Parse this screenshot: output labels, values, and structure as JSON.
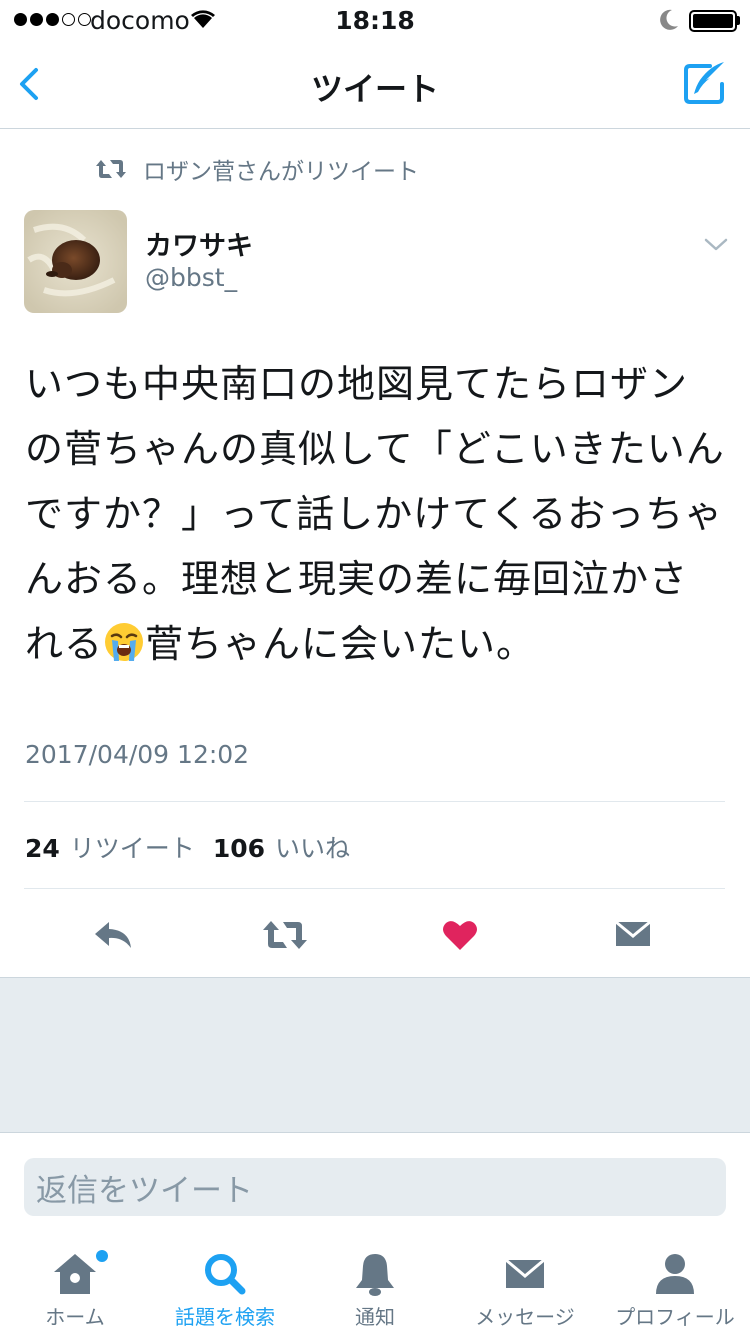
{
  "status_bar": {
    "carrier": "docomo",
    "time": "18:18",
    "signal_bars_filled": 3,
    "signal_bars_total": 5,
    "battery_level": 1.0
  },
  "nav": {
    "title": "ツイート",
    "back_icon": "chevron-left-icon",
    "compose_icon": "compose-quill-icon"
  },
  "tweet": {
    "retweeted_by": "ロザン菅さんがリツイート",
    "author_name": "カワサキ",
    "author_handle": "@bbst_",
    "text_before_emoji": "いつも中央南口の地図見てたらロザンの菅ちゃんの真似して「どこいきたいんですか？」って話しかけてくるおっちゃんおる。理想と現実の差に毎回泣かされる",
    "emoji": "loudly-crying-face",
    "text_after_emoji": "菅ちゃんに会いたい。",
    "timestamp": "2017/04/09 12:02",
    "retweet_count": "24",
    "retweet_label": "リツイート",
    "like_count": "106",
    "like_label": "いいね",
    "liked": true
  },
  "colors": {
    "accent": "#1da1f2",
    "like": "#e0245e",
    "secondary_text": "#657786",
    "action_icon": "#657786"
  },
  "reply": {
    "placeholder": "返信をツイート"
  },
  "tab_bar": {
    "tabs": [
      {
        "label": "ホーム",
        "icon": "home-icon",
        "active": false,
        "badge": true
      },
      {
        "label": "話題を検索",
        "icon": "search-icon",
        "active": true,
        "badge": false
      },
      {
        "label": "通知",
        "icon": "bell-icon",
        "active": false,
        "badge": false
      },
      {
        "label": "メッセージ",
        "icon": "envelope-icon",
        "active": false,
        "badge": false
      },
      {
        "label": "プロフィール",
        "icon": "person-icon",
        "active": false,
        "badge": false
      }
    ]
  }
}
